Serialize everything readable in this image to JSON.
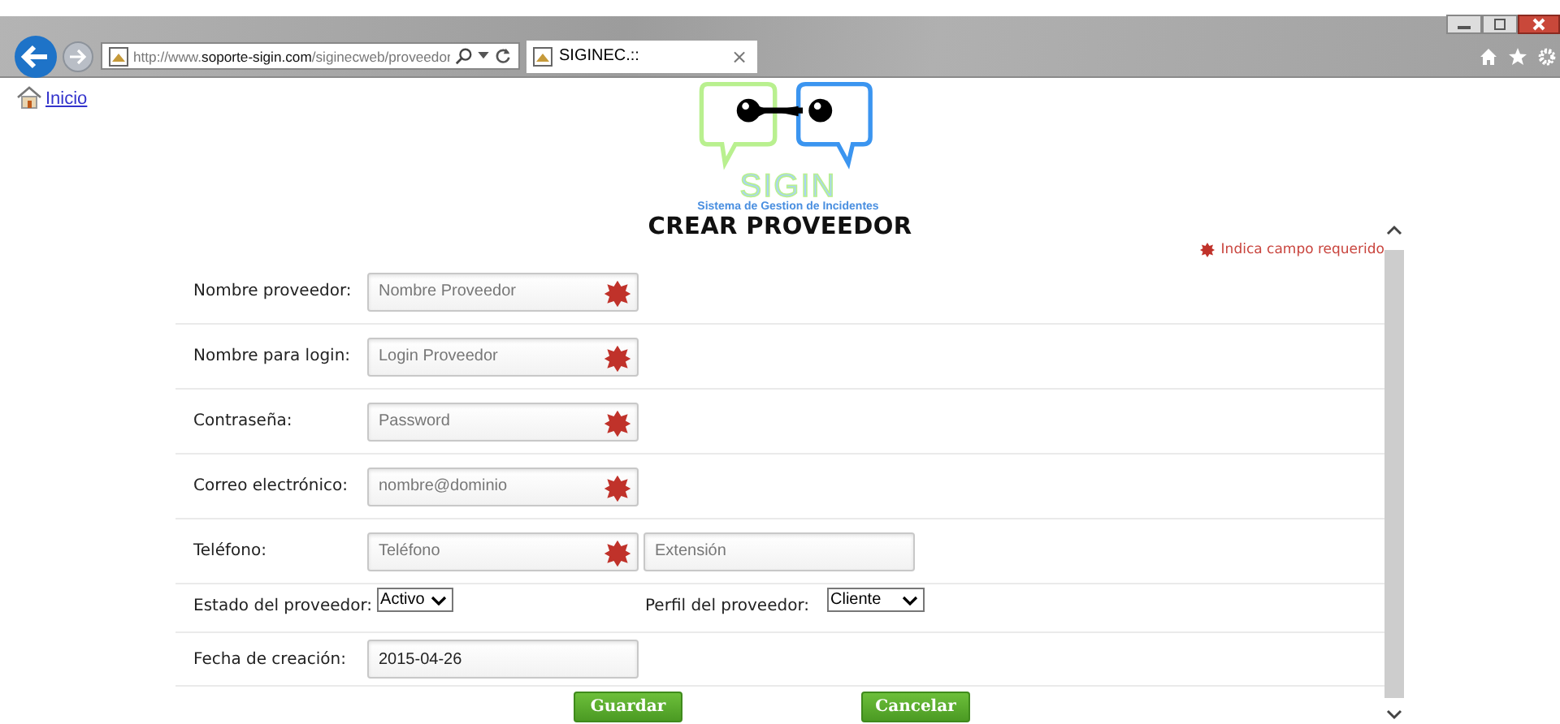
{
  "browser": {
    "url": "http://www.**soporte-sigin.com**/siginecweb/proveedor",
    "tab": {
      "title": "SIGINEC.::",
      "close": "×"
    }
  },
  "home_link": "Inicio",
  "logo": {
    "title": "SIGIN",
    "subtitle": "Sistema de Gestion de Incidentes"
  },
  "heading": "CREAR PROVEEDOR",
  "required_note": "Indica campo requerido",
  "fields": [
    {
      "kind": "text",
      "label": "Nombre proveedor:",
      "placeholder": "Nombre Proveedor",
      "required": true
    },
    {
      "kind": "text",
      "label": "Nombre para login:",
      "placeholder": "Login Proveedor",
      "required": true
    },
    {
      "kind": "text",
      "label": "Contraseña:",
      "placeholder": "Password",
      "required": true
    },
    {
      "kind": "text",
      "label": "Correo electrónico:",
      "placeholder": "nombre@dominio",
      "required": true
    },
    {
      "kind": "phone",
      "label": "Teléfono:",
      "placeholder": "Teléfono",
      "required": true,
      "extension_placeholder": "Extensión"
    },
    {
      "kind": "selects",
      "items": [
        {
          "label": "Estado del proveedor:",
          "value": "Activo"
        },
        {
          "label": "Perfil del proveedor:",
          "value": "Cliente"
        }
      ]
    },
    {
      "kind": "date",
      "label": "Fecha de creación:",
      "value": "2015-04-26",
      "required": false
    }
  ],
  "buttons": [
    "Guardar",
    "Cancelar"
  ]
}
